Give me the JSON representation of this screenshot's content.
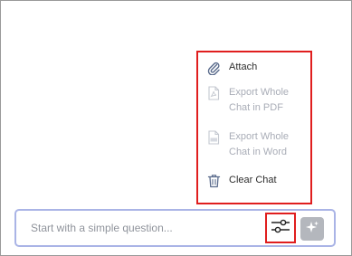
{
  "menu": {
    "items": [
      {
        "label": "Attach",
        "icon": "paperclip-icon",
        "disabled": false
      },
      {
        "label": "Export Whole Chat in PDF",
        "icon": "pdf-file-icon",
        "disabled": true
      },
      {
        "label": "Export Whole Chat in Word",
        "icon": "word-file-icon",
        "disabled": true
      },
      {
        "label": "Clear Chat",
        "icon": "trash-icon",
        "disabled": false
      }
    ]
  },
  "composer": {
    "placeholder": "Start with a simple question...",
    "settings_icon": "sliders-icon",
    "send_icon": "sparkle-icon"
  },
  "colors": {
    "highlight": "#e01e1e",
    "input_border": "#aab4e6",
    "icon_accent": "#5a6b8c",
    "disabled_text": "#a9adb7",
    "send_button": "#b4b7bd"
  }
}
